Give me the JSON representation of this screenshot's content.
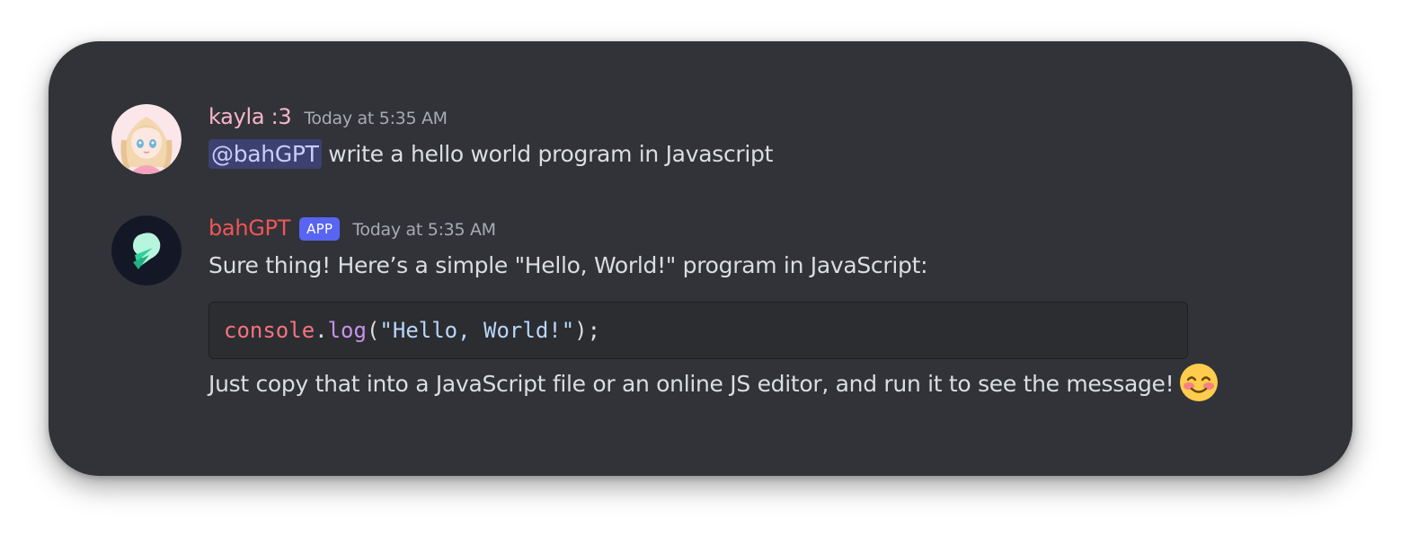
{
  "messages": [
    {
      "username": "kayla :3",
      "username_color": "#f8b7c9",
      "timestamp": "Today at 5:35 AM",
      "mention": "@bahGPT",
      "text": " write a hello world program in Javascript"
    },
    {
      "username": "bahGPT",
      "username_color": "#f05656",
      "badge": "APP",
      "timestamp": "Today at 5:35 AM",
      "intro": "Sure thing! Here’s a simple \"Hello, World!\" program in JavaScript:",
      "code": {
        "object": "console",
        "dot": ".",
        "method": "log",
        "open": "(",
        "string": "\"Hello, World!\"",
        "close": ");"
      },
      "outro": "Just copy that into a JavaScript file or an online JS editor, and run it to see the message!",
      "emoji": "smiling-face-with-smiling-eyes"
    }
  ],
  "colors": {
    "background": "#313338",
    "text": "#dbdee1",
    "timestamp": "#a8abb2",
    "badge": "#5865f2"
  }
}
